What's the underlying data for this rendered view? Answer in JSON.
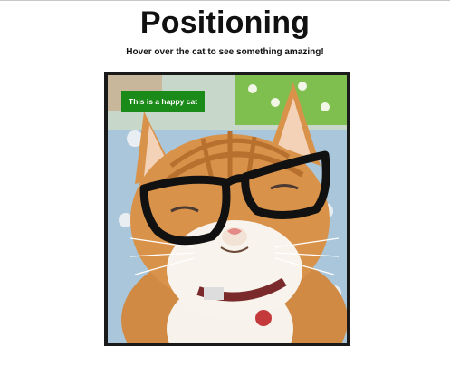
{
  "page": {
    "title": "Positioning",
    "subtitle": "Hover over the cat to see something amazing!"
  },
  "cat": {
    "caption": "This is a happy cat"
  },
  "colors": {
    "caption_bg": "#1a8a18",
    "frame_border": "#1a1a1a"
  }
}
